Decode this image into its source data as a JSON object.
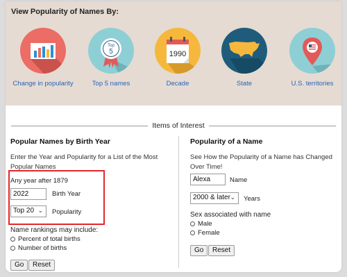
{
  "view": {
    "title": "View Popularity of Names By:",
    "categories": [
      {
        "label": "Change in popularity",
        "color": "#ec6c66",
        "icon": "bar-chart-icon"
      },
      {
        "label": "Top 5 names",
        "color": "#8ecfd5",
        "icon": "top5-badge-icon",
        "badge_text": "Top",
        "badge_num": "5"
      },
      {
        "label": "Decade",
        "color": "#f5b83d",
        "icon": "calendar-icon",
        "year": "1990"
      },
      {
        "label": "State",
        "color": "#1f5c7c",
        "icon": "usa-map-icon"
      },
      {
        "label": "U.S. territories",
        "color": "#8ecfd5",
        "icon": "map-pin-icon"
      }
    ]
  },
  "items_of_interest": "Items of Interest",
  "birth_year": {
    "title": "Popular Names by Birth Year",
    "description": "Enter the Year and Popularity for a List of the Most Popular Names",
    "year_hint": "Any year after 1879",
    "year_value": "2022",
    "year_label": "Birth Year",
    "popularity_value": "Top 20",
    "popularity_label": "Popularity",
    "rankings_label": "Name rankings may include:",
    "options": [
      "Percent of total births",
      "Number of births"
    ],
    "go_label": "Go",
    "reset_label": "Reset"
  },
  "popularity_of_name": {
    "title": "Popularity of a Name",
    "description": "See How the Popularity of a Name has Changed Over Time!",
    "name_value": "Alexa",
    "name_label": "Name",
    "years_value": "2000 & later",
    "years_label": "Years",
    "sex_label": "Sex associated with name",
    "sex_options": [
      "Male",
      "Female"
    ],
    "go_label": "Go",
    "reset_label": "Reset"
  },
  "colors": {
    "panel_bg": "#e5dbd2",
    "link": "#2a62b8",
    "highlight": "#e3262b"
  }
}
